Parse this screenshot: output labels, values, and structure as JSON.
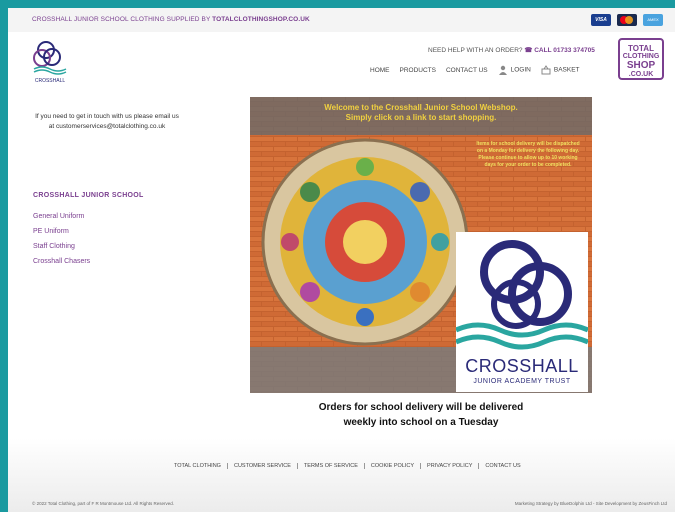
{
  "topbar": {
    "prefix": "CROSSHALL JUNIOR SCHOOL CLOTHING SUPPLIED BY ",
    "site": "TOTALCLOTHINGSHOP.CO.UK",
    "cards": [
      "VISA",
      "mastercard",
      "AMEX"
    ]
  },
  "logo": {
    "caption": "CROSSHALL"
  },
  "header": {
    "help_prefix": "NEED HELP WITH AN ORDER?",
    "phone": "CALL 01733 374705",
    "nav": {
      "home": "HOME",
      "products": "PRODUCTS",
      "contact": "CONTACT US",
      "login": "LOGIN",
      "basket": "BASKET"
    },
    "brand": {
      "line1": "TOTAL",
      "line2": "CLOTHING",
      "line3": "SHOP",
      "line4": ".CO.UK"
    }
  },
  "sidebar": {
    "message": "If you need to get in touch with us please email us at customerservices@totalclothing.co.uk",
    "heading": "CROSSHALL JUNIOR SCHOOL",
    "links": [
      "General Uniform",
      "PE Uniform",
      "Staff Clothing",
      "Crosshall Chasers"
    ]
  },
  "hero": {
    "title_line1": "Welcome to the Crosshall Junior School Webshop.",
    "title_line2": "Simply click on a link to start shopping.",
    "note": "Items for school delivery will be dispatched on a Monday for delivery the following day. Please continue to allow up to 10 working days for your order to be completed.",
    "crest_title": "CROSSHALL",
    "crest_sub": "JUNIOR ACADEMY TRUST"
  },
  "delivery": {
    "line1": "Orders for school delivery will be delivered",
    "line2": "weekly into school on a Tuesday"
  },
  "footer": {
    "links": [
      "TOTAL CLOTHING",
      "CUSTOMER SERVICE",
      "TERMS OF SERVICE",
      "COOKIE POLICY",
      "PRIVACY POLICY",
      "CONTACT US"
    ],
    "copyright": "© 2022 Total Clothing, part of F R Montmouse Ltd. All Rights Reserved.",
    "credits": "Marketing Strategy by BlueDolphin Ltd - Site Development by ZeusFinch Ltd"
  },
  "colors": {
    "brand": "#7a3f8f",
    "frame": "#1a9aa0",
    "crest": "#2a2a78",
    "wave": "#2aa6a0"
  }
}
